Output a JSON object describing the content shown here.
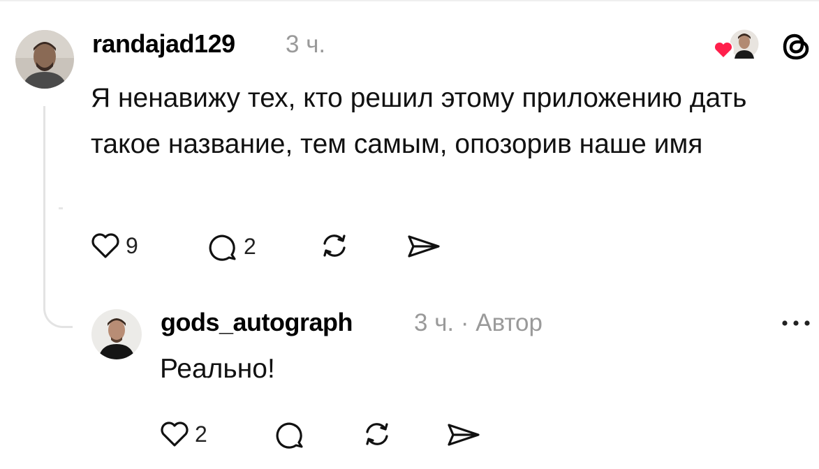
{
  "post": {
    "username": "randajad129",
    "time": "3 ч.",
    "text": "Я ненавижу тех, кто решил этому приложению дать такое название, тем самым, опозорив наше имя",
    "likes": "9",
    "replies": "2"
  },
  "reply": {
    "username": "gods_autograph",
    "meta": "3 ч. · Автор",
    "text": "Реально!",
    "likes": "2"
  },
  "icons": {
    "like": "heart-icon",
    "comment": "comment-icon",
    "repost": "repost-icon",
    "share": "share-icon",
    "app": "threads-icon",
    "more": "more-icon"
  },
  "colors": {
    "heart_red": "#ff1f4b",
    "meta_gray": "#9a9a9a",
    "thread_line": "#e3e3e3"
  }
}
